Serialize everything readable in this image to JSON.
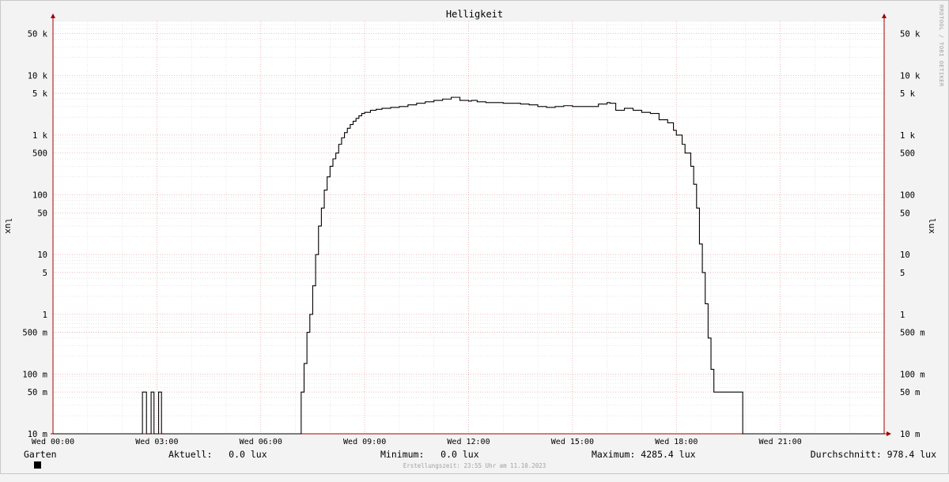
{
  "chart_data": {
    "type": "line",
    "title": "Helligkeit",
    "ylabel": "lux",
    "yscale": "log",
    "ylim": [
      0.01,
      80000
    ],
    "xlim": [
      "Wed 00:00",
      "Wed 24:00"
    ],
    "x_tick_labels": [
      "Wed 00:00",
      "Wed 03:00",
      "Wed 06:00",
      "Wed 09:00",
      "Wed 12:00",
      "Wed 15:00",
      "Wed 18:00",
      "Wed 21:00"
    ],
    "y_tick_labels": [
      "10 m",
      "50 m",
      "100 m",
      "500 m",
      "1",
      "5",
      "10",
      "50",
      "100",
      "500",
      "1 k",
      "5 k",
      "10 k",
      "50 k"
    ],
    "y_tick_values": [
      0.01,
      0.05,
      0.1,
      0.5,
      1,
      5,
      10,
      50,
      100,
      500,
      1000,
      5000,
      10000,
      50000
    ],
    "grid": true,
    "series": [
      {
        "name": "Garten",
        "color": "#000000",
        "x": [
          "02:35",
          "02:42",
          "02:50",
          "02:55",
          "03:03",
          "03:08",
          "07:10",
          "07:15",
          "07:20",
          "07:25",
          "07:30",
          "07:35",
          "07:40",
          "07:45",
          "07:50",
          "07:55",
          "08:00",
          "08:05",
          "08:10",
          "08:15",
          "08:20",
          "08:25",
          "08:30",
          "08:35",
          "08:40",
          "08:45",
          "08:50",
          "08:55",
          "09:00",
          "09:10",
          "09:20",
          "09:30",
          "09:45",
          "10:00",
          "10:15",
          "10:30",
          "10:45",
          "11:00",
          "11:15",
          "11:30",
          "11:45",
          "12:00",
          "12:05",
          "12:15",
          "12:30",
          "12:45",
          "13:00",
          "13:15",
          "13:30",
          "13:45",
          "14:00",
          "14:15",
          "14:30",
          "14:45",
          "15:00",
          "15:15",
          "15:30",
          "15:45",
          "16:00",
          "16:05",
          "16:15",
          "16:30",
          "16:45",
          "17:00",
          "17:15",
          "17:30",
          "17:45",
          "17:55",
          "18:00",
          "18:10",
          "18:15",
          "18:25",
          "18:30",
          "18:35",
          "18:40",
          "18:45",
          "18:50",
          "18:55",
          "19:00",
          "19:05",
          "19:10",
          "19:15",
          "19:20",
          "19:25",
          "19:30",
          "19:35",
          "19:40",
          "19:50",
          "19:55"
        ],
        "y": [
          0.05,
          0.05,
          0.05,
          0.05,
          0.05,
          0.05,
          0.05,
          0.15,
          0.5,
          1,
          3,
          10,
          30,
          60,
          120,
          200,
          300,
          400,
          500,
          700,
          900,
          1100,
          1300,
          1500,
          1700,
          1900,
          2100,
          2300,
          2400,
          2600,
          2700,
          2800,
          2900,
          3000,
          3200,
          3400,
          3600,
          3800,
          4000,
          4285,
          3800,
          3700,
          3800,
          3600,
          3500,
          3500,
          3400,
          3400,
          3300,
          3200,
          3000,
          2900,
          3000,
          3100,
          3000,
          3000,
          3000,
          3300,
          3500,
          3400,
          2600,
          2800,
          2600,
          2400,
          2300,
          1800,
          1600,
          1200,
          1000,
          700,
          500,
          300,
          150,
          60,
          15,
          5,
          1.5,
          0.4,
          0.12,
          0.05,
          0.05,
          0.05,
          0.05,
          0.05,
          0.05,
          0.05,
          0.05,
          0.05,
          0.01
        ]
      }
    ]
  },
  "legend": {
    "name": "Garten",
    "current": "Aktuell:   0.0 lux",
    "minimum": "Minimum:   0.0 lux",
    "maximum": "Maximum: 4285.4 lux",
    "average": "Durchschnitt: 978.4 lux"
  },
  "footer": "Erstellungszeit: 23:55 Uhr am 11.10.2023",
  "watermark": "RRDTOOL / TOBI OETIKER",
  "colors": {
    "background": "#f3f3f3",
    "plot": "#ffffff",
    "grid_major": "#e8a3a3",
    "grid_minor": "#d6d6d6",
    "line": "#000000",
    "axis_arrow": "#a30000"
  }
}
